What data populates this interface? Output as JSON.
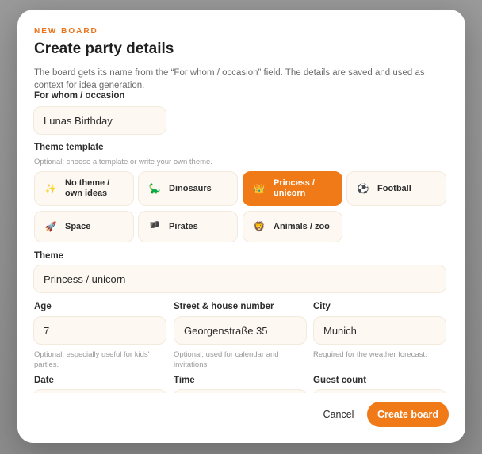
{
  "modal": {
    "eyebrow": "NEW BOARD",
    "title": "Create party details",
    "description": "The board gets its name from the “For whom / occasion” field. The details are saved and used as context for idea generation."
  },
  "occasion": {
    "label": "For whom / occasion",
    "value": "Lunas Birthday"
  },
  "theme_template": {
    "label": "Theme template",
    "hint": "Optional: choose a template or write your own theme.",
    "options": [
      {
        "label": "No theme / own ideas",
        "icon": "sparkles-icon",
        "glyph": "✨",
        "selected": false
      },
      {
        "label": "Dinosaurs",
        "icon": "dinosaur-icon",
        "glyph": "🦕",
        "selected": false
      },
      {
        "label": "Princess / unicorn",
        "icon": "crown-icon",
        "glyph": "👑",
        "selected": true
      },
      {
        "label": "Football",
        "icon": "football-icon",
        "glyph": "⚽",
        "selected": false
      },
      {
        "label": "Space",
        "icon": "rocket-icon",
        "glyph": "🚀",
        "selected": false
      },
      {
        "label": "Pirates",
        "icon": "pirate-flag-icon",
        "glyph": "🏴",
        "selected": false
      },
      {
        "label": "Animals / zoo",
        "icon": "lion-icon",
        "glyph": "🦁",
        "selected": false
      }
    ]
  },
  "theme": {
    "label": "Theme",
    "value": "Princess / unicorn"
  },
  "age": {
    "label": "Age",
    "value": "7",
    "hint": "Optional, especially useful for kids' parties."
  },
  "street": {
    "label": "Street & house number",
    "value": "Georgenstraße 35",
    "hint": "Optional, used for calendar and invitations."
  },
  "city": {
    "label": "City",
    "value": "Munich",
    "hint": "Required for the weather forecast."
  },
  "date": {
    "label": "Date"
  },
  "time": {
    "label": "Time"
  },
  "guest_count": {
    "label": "Guest count"
  },
  "footer": {
    "cancel_label": "Cancel",
    "create_label": "Create board"
  },
  "colors": {
    "accent": "#ef7a17",
    "eyebrow": "#e8731a",
    "field_bg": "#fdf8f2"
  }
}
